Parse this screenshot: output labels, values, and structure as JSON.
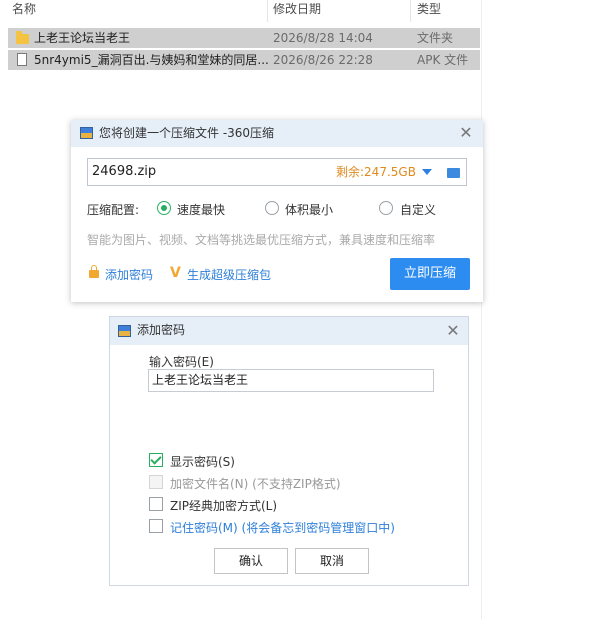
{
  "explorer": {
    "columns": {
      "name": "名称",
      "modified": "修改日期",
      "type": "类型"
    },
    "rows": [
      {
        "name": "上老王论坛当老王",
        "modified": "2026/8/28 14:04",
        "type": "文件夹",
        "icon": "folder-icon"
      },
      {
        "name": "5nr4ymi5_漏洞百出.与姨妈和堂妹的同居...",
        "modified": "2026/8/26 22:28",
        "type": "APK 文件",
        "icon": "file-icon"
      }
    ]
  },
  "compress_dialog": {
    "title": "您将创建一个压缩文件 -360压缩",
    "filename": "24698.zip",
    "free_space": "剩余:247.5GB",
    "config_label": "压缩配置:",
    "options": [
      {
        "label": "速度最快",
        "selected": true
      },
      {
        "label": "体积最小",
        "selected": false
      },
      {
        "label": "自定义",
        "selected": false
      }
    ],
    "hint": "智能为图片、视频、文档等挑选最优压缩方式，兼具速度和压缩率",
    "add_password": "添加密码",
    "super_package": "生成超级压缩包",
    "compress_now": "立即压缩"
  },
  "password_dialog": {
    "title": "添加密码",
    "input_label": "输入密码(E)",
    "password_value": "上老王论坛当老王",
    "checkboxes": [
      {
        "label": "显示密码(S)",
        "checked": true,
        "disabled": false,
        "style": "normal"
      },
      {
        "label": "加密文件名(N)  (不支持ZIP格式)",
        "checked": false,
        "disabled": true,
        "style": "disabled"
      },
      {
        "label": "ZIP经典加密方式(L)",
        "checked": false,
        "disabled": false,
        "style": "normal"
      },
      {
        "label": "记住密码(M)  (将会备忘到密码管理窗口中)",
        "checked": false,
        "disabled": false,
        "style": "blue"
      }
    ],
    "ok": "确认",
    "cancel": "取消"
  },
  "colors": {
    "accent": "#2d8cf0",
    "radio_green": "#27ae60",
    "free_space_orange": "#e08a1e",
    "title_bar": "#e6eef8",
    "row_selected": "#cfcfcf"
  }
}
